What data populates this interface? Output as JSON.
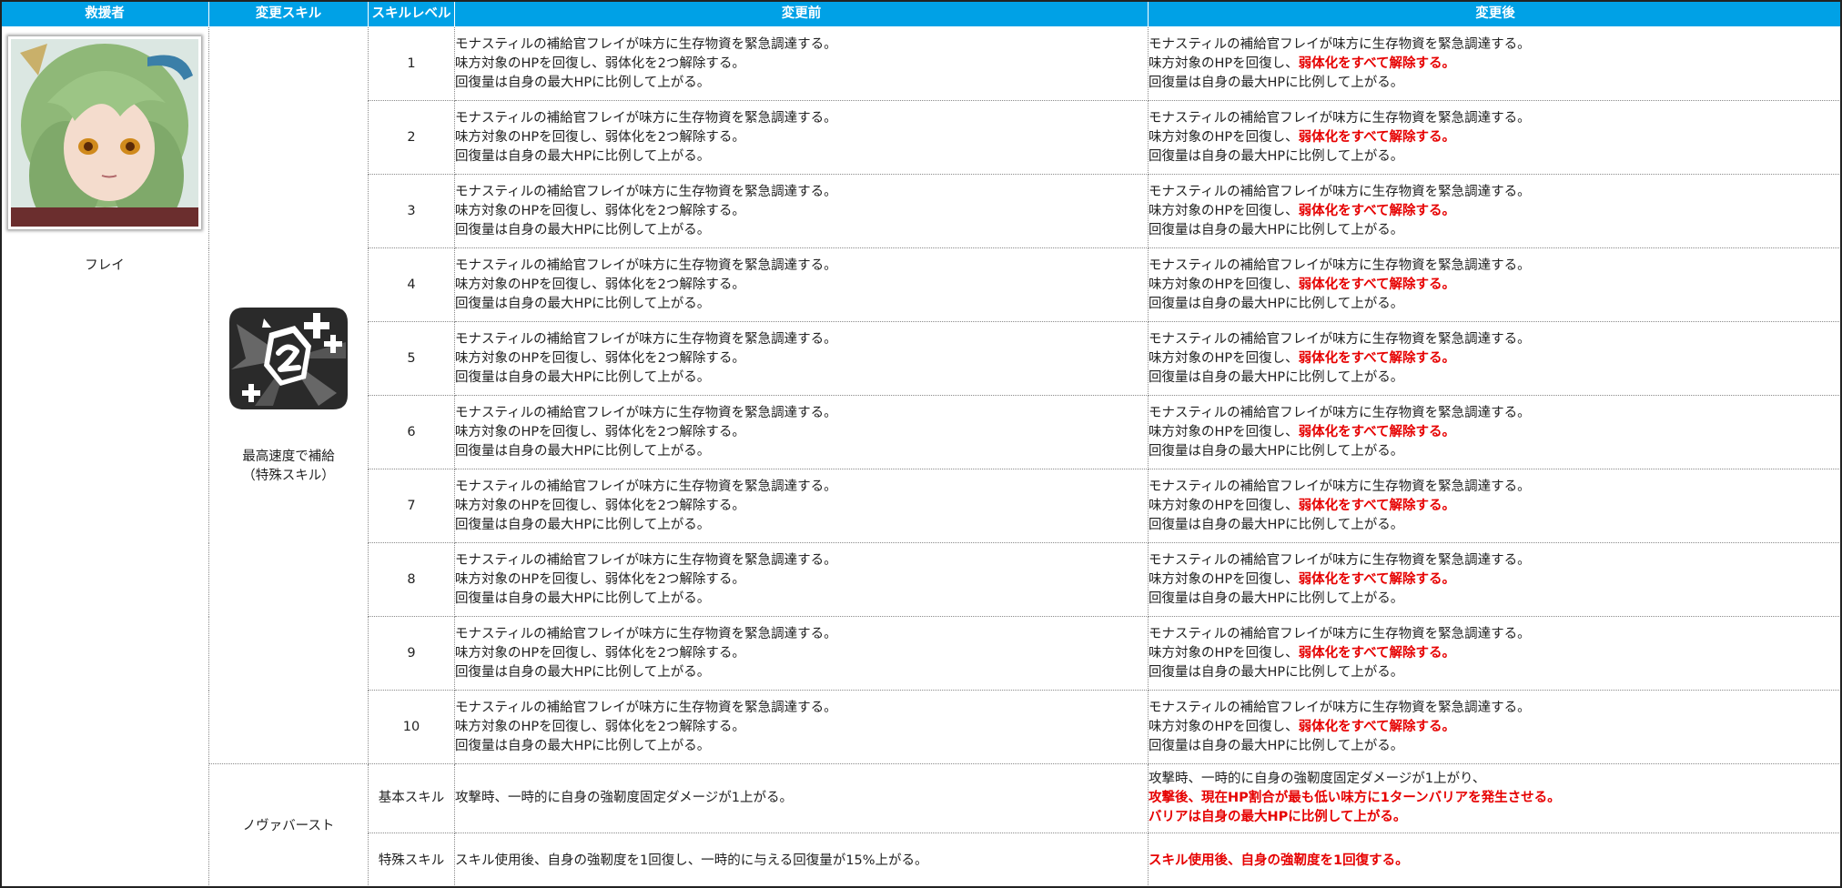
{
  "headers": {
    "rescuer": "救援者",
    "skill": "変更スキル",
    "level": "スキルレベル",
    "before": "変更前",
    "after": "変更後"
  },
  "rescuer": {
    "name": "フレイ",
    "portrait_icon": "character-portrait-frey"
  },
  "special_skill": {
    "icon": "supply-skill-icon",
    "name_line1": "最高速度で補給",
    "name_line2": "（特殊スキル）"
  },
  "levels": [
    {
      "level": "1",
      "before": [
        "モナスティルの補給官フレイが味方に生存物資を緊急調達する。",
        "味方対象のHPを回復し、弱体化を2つ解除する。",
        "回復量は自身の最大HPに比例して上がる。"
      ],
      "after": {
        "line1": "モナスティルの補給官フレイが味方に生存物資を緊急調達する。",
        "line2_plain": "味方対象のHPを回復し、",
        "line2_highlight": "弱体化をすべて解除する。",
        "line3": "回復量は自身の最大HPに比例して上がる。"
      }
    },
    {
      "level": "2",
      "before": [
        "モナスティルの補給官フレイが味方に生存物資を緊急調達する。",
        "味方対象のHPを回復し、弱体化を2つ解除する。",
        "回復量は自身の最大HPに比例して上がる。"
      ],
      "after": {
        "line1": "モナスティルの補給官フレイが味方に生存物資を緊急調達する。",
        "line2_plain": "味方対象のHPを回復し、",
        "line2_highlight": "弱体化をすべて解除する。",
        "line3": "回復量は自身の最大HPに比例して上がる。"
      }
    },
    {
      "level": "3",
      "before": [
        "モナスティルの補給官フレイが味方に生存物資を緊急調達する。",
        "味方対象のHPを回復し、弱体化を2つ解除する。",
        "回復量は自身の最大HPに比例して上がる。"
      ],
      "after": {
        "line1": "モナスティルの補給官フレイが味方に生存物資を緊急調達する。",
        "line2_plain": "味方対象のHPを回復し、",
        "line2_highlight": "弱体化をすべて解除する。",
        "line3": "回復量は自身の最大HPに比例して上がる。"
      }
    },
    {
      "level": "4",
      "before": [
        "モナスティルの補給官フレイが味方に生存物資を緊急調達する。",
        "味方対象のHPを回復し、弱体化を2つ解除する。",
        "回復量は自身の最大HPに比例して上がる。"
      ],
      "after": {
        "line1": "モナスティルの補給官フレイが味方に生存物資を緊急調達する。",
        "line2_plain": "味方対象のHPを回復し、",
        "line2_highlight": "弱体化をすべて解除する。",
        "line3": "回復量は自身の最大HPに比例して上がる。"
      }
    },
    {
      "level": "5",
      "before": [
        "モナスティルの補給官フレイが味方に生存物資を緊急調達する。",
        "味方対象のHPを回復し、弱体化を2つ解除する。",
        "回復量は自身の最大HPに比例して上がる。"
      ],
      "after": {
        "line1": "モナスティルの補給官フレイが味方に生存物資を緊急調達する。",
        "line2_plain": "味方対象のHPを回復し、",
        "line2_highlight": "弱体化をすべて解除する。",
        "line3": "回復量は自身の最大HPに比例して上がる。"
      }
    },
    {
      "level": "6",
      "before": [
        "モナスティルの補給官フレイが味方に生存物資を緊急調達する。",
        "味方対象のHPを回復し、弱体化を2つ解除する。",
        "回復量は自身の最大HPに比例して上がる。"
      ],
      "after": {
        "line1": "モナスティルの補給官フレイが味方に生存物資を緊急調達する。",
        "line2_plain": "味方対象のHPを回復し、",
        "line2_highlight": "弱体化をすべて解除する。",
        "line3": "回復量は自身の最大HPに比例して上がる。"
      }
    },
    {
      "level": "7",
      "before": [
        "モナスティルの補給官フレイが味方に生存物資を緊急調達する。",
        "味方対象のHPを回復し、弱体化を2つ解除する。",
        "回復量は自身の最大HPに比例して上がる。"
      ],
      "after": {
        "line1": "モナスティルの補給官フレイが味方に生存物資を緊急調達する。",
        "line2_plain": "味方対象のHPを回復し、",
        "line2_highlight": "弱体化をすべて解除する。",
        "line3": "回復量は自身の最大HPに比例して上がる。"
      }
    },
    {
      "level": "8",
      "before": [
        "モナスティルの補給官フレイが味方に生存物資を緊急調達する。",
        "味方対象のHPを回復し、弱体化を2つ解除する。",
        "回復量は自身の最大HPに比例して上がる。"
      ],
      "after": {
        "line1": "モナスティルの補給官フレイが味方に生存物資を緊急調達する。",
        "line2_plain": "味方対象のHPを回復し、",
        "line2_highlight": "弱体化をすべて解除する。",
        "line3": "回復量は自身の最大HPに比例して上がる。"
      }
    },
    {
      "level": "9",
      "before": [
        "モナスティルの補給官フレイが味方に生存物資を緊急調達する。",
        "味方対象のHPを回復し、弱体化を2つ解除する。",
        "回復量は自身の最大HPに比例して上がる。"
      ],
      "after": {
        "line1": "モナスティルの補給官フレイが味方に生存物資を緊急調達する。",
        "line2_plain": "味方対象のHPを回復し、",
        "line2_highlight": "弱体化をすべて解除する。",
        "line3": "回復量は自身の最大HPに比例して上がる。"
      }
    },
    {
      "level": "10",
      "before": [
        "モナスティルの補給官フレイが味方に生存物資を緊急調達する。",
        "味方対象のHPを回復し、弱体化を2つ解除する。",
        "回復量は自身の最大HPに比例して上がる。"
      ],
      "after": {
        "line1": "モナスティルの補給官フレイが味方に生存物資を緊急調達する。",
        "line2_plain": "味方対象のHPを回復し、",
        "line2_highlight": "弱体化をすべて解除する。",
        "line3": "回復量は自身の最大HPに比例して上がる。"
      }
    }
  ],
  "nova_burst": {
    "name": "ノヴァバースト",
    "basic": {
      "label": "基本スキル",
      "before": "攻撃時、一時的に自身の強靭度固定ダメージが1上がる。",
      "after_plain": "攻撃時、一時的に自身の強靭度固定ダメージが1上がり、",
      "after_highlight1": "攻撃後、現在HP割合が最も低い味方に1ターンバリアを発生させる。",
      "after_highlight2": "バリアは自身の最大HPに比例して上がる。"
    },
    "special": {
      "label": "特殊スキル",
      "before": "スキル使用後、自身の強靭度を1回復し、一時的に与える回復量が15%上がる。",
      "after_highlight": "スキル使用後、自身の強靭度を1回復する。"
    }
  },
  "colors": {
    "header_bg": "#00a1e6",
    "highlight": "#e60000"
  }
}
